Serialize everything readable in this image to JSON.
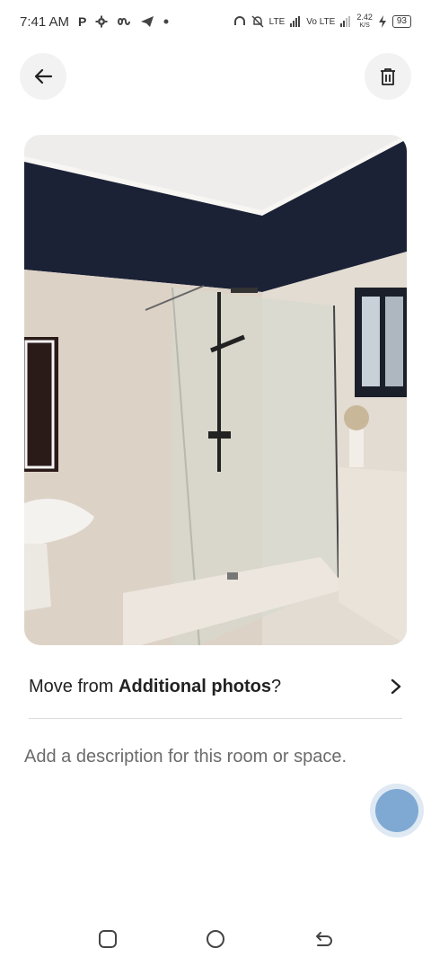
{
  "status_bar": {
    "time": "7:41 AM",
    "app_glyph": "P",
    "network_speed": "2.42",
    "network_unit": "K/S",
    "battery": "93",
    "signal_labels": [
      "LTE",
      "Vo LTE"
    ]
  },
  "header": {
    "back_icon": "arrow-left-icon",
    "delete_icon": "trash-icon"
  },
  "photo": {
    "subject": "bathroom-shower-photo"
  },
  "move": {
    "prefix": "Move from ",
    "album": "Additional photos",
    "suffix": "?"
  },
  "description": {
    "placeholder": "Add a description for this room or space.",
    "value": ""
  },
  "colors": {
    "accent": "#7fa9d3",
    "button_bg": "#f2f2f2"
  },
  "nav": [
    "recents-icon",
    "home-icon",
    "back-icon"
  ]
}
